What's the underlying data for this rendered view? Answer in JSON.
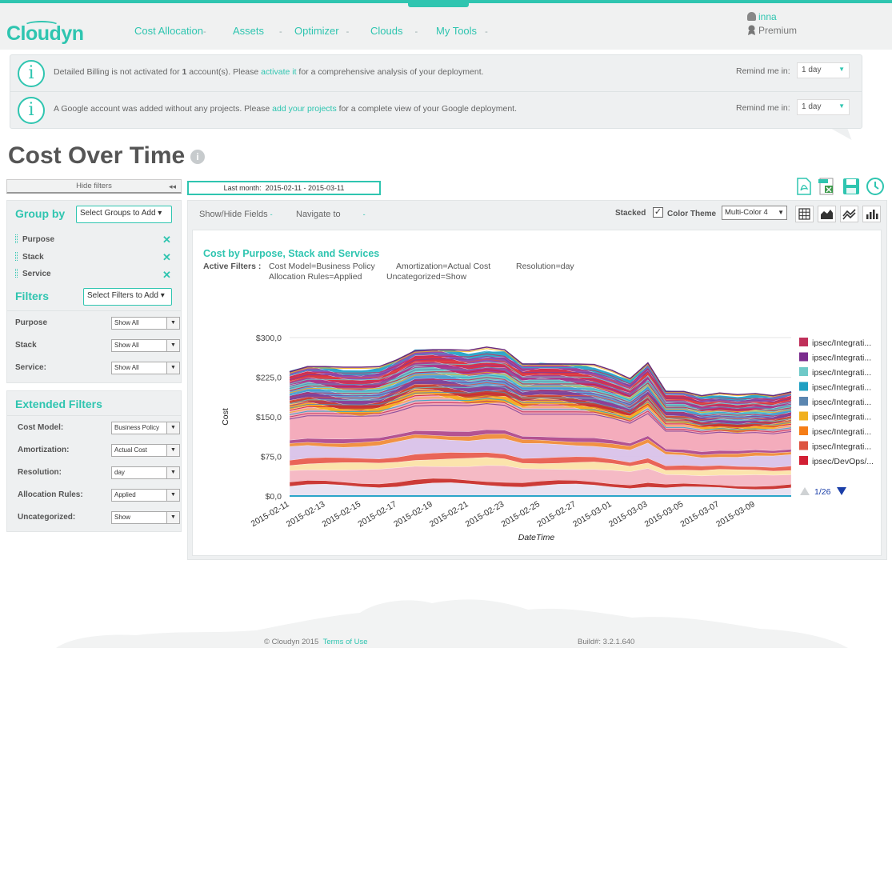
{
  "brand": {
    "name": "Cloudyn",
    "accent": "#2fc5b0"
  },
  "nav": {
    "items": [
      {
        "label": "Cost Allocation",
        "suffix": "-"
      },
      {
        "label": "Assets",
        "suffix": "-"
      },
      {
        "label": "Optimizer",
        "suffix": "-"
      },
      {
        "label": "Clouds",
        "suffix": "-"
      },
      {
        "label": "My Tools",
        "suffix": "-"
      }
    ]
  },
  "user": {
    "name": "inna",
    "plan": "Premium"
  },
  "notices": [
    {
      "before": "Detailed Billing is not activated for ",
      "bold": "1",
      "middle": " account(s). Please ",
      "link": "activate it",
      "after": " for a comprehensive analysis of your deployment.",
      "remind_label": "Remind me in:",
      "remind_value": "1 day"
    },
    {
      "before": "A Google account was added without any projects. Please ",
      "bold": "",
      "middle": "",
      "link": "add your projects",
      "after": " for a complete view of your Google deployment.",
      "remind_label": "Remind me in:",
      "remind_value": "1 day"
    }
  ],
  "page": {
    "title": "Cost Over Time",
    "info_icon": "i"
  },
  "filters_toggle": {
    "label": "Hide filters"
  },
  "date_range": {
    "label": "Last month:",
    "value": "2015-02-11 - 2015-03-11"
  },
  "group_by": {
    "title": "Group by",
    "select": "Select Groups to Add",
    "items": [
      "Purpose",
      "Stack",
      "Service"
    ]
  },
  "filters": {
    "title": "Filters",
    "select": "Select Filters to Add",
    "rows": [
      {
        "label": "Purpose",
        "value": "Show All"
      },
      {
        "label": "Stack",
        "value": "Show All"
      },
      {
        "label": "Service:",
        "value": "Show All"
      }
    ]
  },
  "extended_filters": {
    "title": "Extended Filters",
    "rows": [
      {
        "label": "Cost Model:",
        "value": "Business Policy"
      },
      {
        "label": "Amortization:",
        "value": "Actual Cost"
      },
      {
        "label": "Resolution:",
        "value": "day"
      },
      {
        "label": "Allocation Rules:",
        "value": "Applied"
      },
      {
        "label": "Uncategorized:",
        "value": "Show"
      }
    ]
  },
  "chart_toolbar": {
    "show_hide": "Show/Hide Fields",
    "navigate": "Navigate to",
    "stacked_label": "Stacked",
    "stacked_checked": true,
    "color_theme_label": "Color Theme",
    "color_theme_value": "Multi-Color 4"
  },
  "chart_heading": {
    "title": "Cost by Purpose, Stack and Services",
    "active_label": "Active Filters :",
    "active_filters_line1": [
      "Cost Model=Business Policy",
      "Amortization=Actual Cost",
      "Resolution=day"
    ],
    "active_filters_line2": [
      "Allocation Rules=Applied",
      "Uncategorized=Show"
    ]
  },
  "chart_data": {
    "type": "area",
    "stacked": true,
    "xlabel": "DateTime",
    "ylabel": "Cost",
    "ylim": [
      0,
      300
    ],
    "y_ticks": [
      "$0,0",
      "$75,0",
      "$150,0",
      "$225,0",
      "$300,0"
    ],
    "x": [
      "2015-02-11",
      "2015-02-12",
      "2015-02-13",
      "2015-02-14",
      "2015-02-15",
      "2015-02-16",
      "2015-02-17",
      "2015-02-18",
      "2015-02-19",
      "2015-02-20",
      "2015-02-21",
      "2015-02-22",
      "2015-02-23",
      "2015-02-24",
      "2015-02-25",
      "2015-02-26",
      "2015-02-27",
      "2015-02-28",
      "2015-03-01",
      "2015-03-02",
      "2015-03-03",
      "2015-03-04",
      "2015-03-05",
      "2015-03-06",
      "2015-03-07",
      "2015-03-08",
      "2015-03-09",
      "2015-03-10",
      "2015-03-11"
    ],
    "x_tick_labels": [
      "2015-02-11",
      "2015-02-13",
      "2015-02-15",
      "2015-02-17",
      "2015-02-19",
      "2015-02-21",
      "2015-02-23",
      "2015-02-25",
      "2015-02-27",
      "2015-03-01",
      "2015-03-03",
      "2015-03-05",
      "2015-03-07",
      "2015-03-09"
    ],
    "total": [
      235,
      245,
      245,
      244,
      244,
      245,
      258,
      275,
      277,
      277,
      276,
      282,
      277,
      250,
      250,
      250,
      250,
      249,
      238,
      222,
      252,
      198,
      198,
      190,
      195,
      192,
      194,
      190,
      197
    ],
    "bands": [
      {
        "color": "#e8e0f0",
        "share": 0.08
      },
      {
        "color": "#c9302c",
        "share": 0.03
      },
      {
        "color": "#f4b6c2",
        "share": 0.1
      },
      {
        "color": "#fbe3a8",
        "share": 0.05
      },
      {
        "color": "#e85d4f",
        "share": 0.04
      },
      {
        "color": "#d9c2e9",
        "share": 0.1
      },
      {
        "color": "#f08c3a",
        "share": 0.03
      },
      {
        "color": "#b04a8c",
        "share": 0.03
      },
      {
        "color": "#f3a8b8",
        "share": 0.22
      },
      {
        "color": "#f6a623",
        "share": 0.04
      },
      {
        "color": "#c0392b",
        "share": 0.04
      },
      {
        "color": "#7b3f98",
        "share": 0.04
      },
      {
        "color": "#5b9bd5",
        "share": 0.04
      },
      {
        "color": "#6cc6c6",
        "share": 0.04
      },
      {
        "color": "#a5338a",
        "share": 0.04
      },
      {
        "color": "#d8273f",
        "share": 0.04
      },
      {
        "color": "#8e44ad",
        "share": 0.04
      },
      {
        "color": "#2aa5c9",
        "share": 0.03
      }
    ],
    "legend": [
      {
        "name": "ipsec/Integrati...",
        "color": "#c0305a"
      },
      {
        "name": "ipsec/Integrati...",
        "color": "#7b2d8e"
      },
      {
        "name": "ipsec/Integrati...",
        "color": "#6ec9c8"
      },
      {
        "name": "ipsec/Integrati...",
        "color": "#1e9fc2"
      },
      {
        "name": "ipsec/Integrati...",
        "color": "#5b86b0"
      },
      {
        "name": "ipsec/Integrati...",
        "color": "#f0b01e"
      },
      {
        "name": "ipsec/Integrati...",
        "color": "#f57d17"
      },
      {
        "name": "ipsec/Integrati...",
        "color": "#dd5440"
      },
      {
        "name": "ipsec/DevOps/...",
        "color": "#d21f34"
      }
    ],
    "legend_page": "1/26"
  },
  "footer": {
    "copyright": "© Cloudyn 2015",
    "terms": "Terms of Use",
    "build": "Build#: 3.2.1.640"
  }
}
